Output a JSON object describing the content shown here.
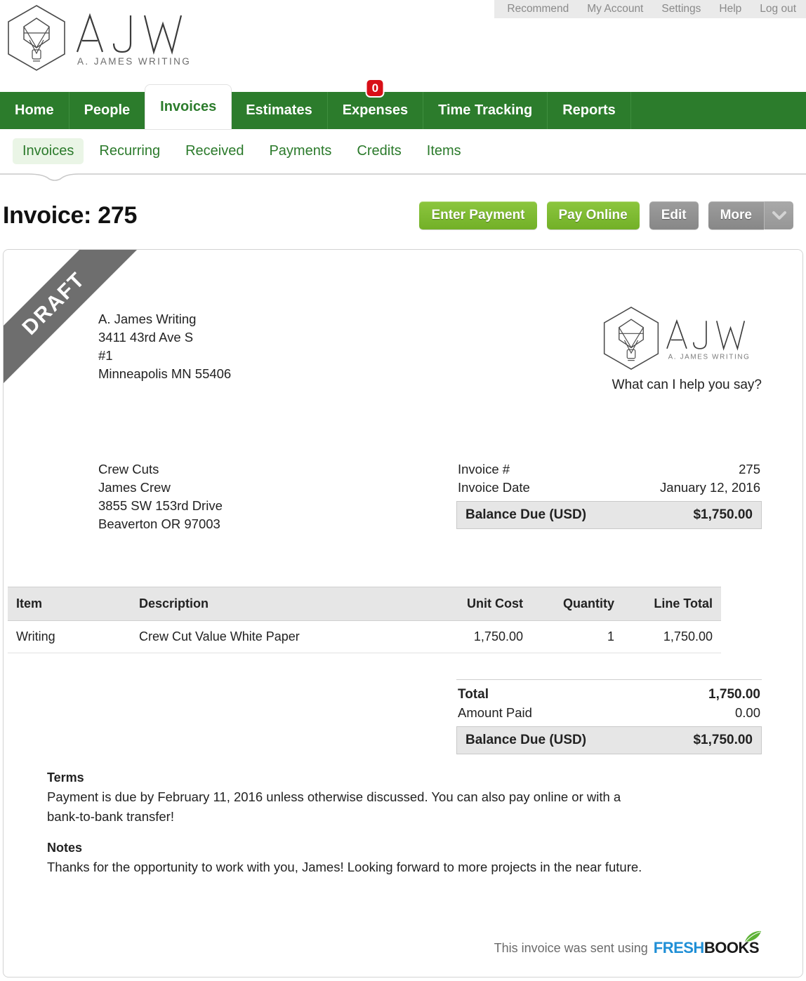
{
  "topbar": {
    "links": [
      {
        "label": "Recommend"
      },
      {
        "label": "My Account"
      },
      {
        "label": "Settings"
      },
      {
        "label": "Help"
      },
      {
        "label": "Log out"
      }
    ]
  },
  "brand": {
    "wordmark": "AJW",
    "subtitle": "A. JAMES WRITING"
  },
  "mainnav": {
    "tabs": [
      {
        "label": "Home",
        "active": false
      },
      {
        "label": "People",
        "active": false
      },
      {
        "label": "Invoices",
        "active": true
      },
      {
        "label": "Estimates",
        "active": false
      },
      {
        "label": "Expenses",
        "active": false,
        "badge": "0"
      },
      {
        "label": "Time Tracking",
        "active": false
      },
      {
        "label": "Reports",
        "active": false
      }
    ]
  },
  "subnav": {
    "items": [
      {
        "label": "Invoices",
        "active": true
      },
      {
        "label": "Recurring",
        "active": false
      },
      {
        "label": "Received",
        "active": false
      },
      {
        "label": "Payments",
        "active": false
      },
      {
        "label": "Credits",
        "active": false
      },
      {
        "label": "Items",
        "active": false
      }
    ]
  },
  "page": {
    "title": "Invoice: 275",
    "actions": {
      "enter_payment": "Enter Payment",
      "pay_online": "Pay Online",
      "edit": "Edit",
      "more": "More"
    }
  },
  "invoice": {
    "status_ribbon": "DRAFT",
    "from": {
      "name": "A. James Writing",
      "line1": "3411 43rd Ave S",
      "line2": "#1",
      "line3": "Minneapolis MN  55406"
    },
    "logo": {
      "wordmark": "AJW",
      "subtitle": "A. JAMES WRITING",
      "tagline": "What can I help you say?"
    },
    "bill_to": {
      "company": "Crew Cuts",
      "contact": "James Crew",
      "street": "3855 SW 153rd Drive",
      "citystate": "Beaverton OR  97003"
    },
    "meta": {
      "number_label": "Invoice #",
      "number_value": "275",
      "date_label": "Invoice Date",
      "date_value": "January 12, 2016",
      "balance_label": "Balance Due (USD)",
      "balance_value": "$1,750.00"
    },
    "table": {
      "headers": {
        "item": "Item",
        "description": "Description",
        "unit_cost": "Unit Cost",
        "quantity": "Quantity",
        "line_total": "Line Total"
      },
      "rows": [
        {
          "item": "Writing",
          "description": "Crew Cut Value White Paper",
          "unit_cost": "1,750.00",
          "quantity": "1",
          "line_total": "1,750.00"
        }
      ]
    },
    "totals": {
      "total_label": "Total",
      "total_value": "1,750.00",
      "paid_label": "Amount Paid",
      "paid_value": "0.00",
      "balance_label": "Balance Due (USD)",
      "balance_value": "$1,750.00"
    },
    "terms": {
      "heading": "Terms",
      "body": "Payment is due by February 11, 2016 unless otherwise discussed. You can also pay online or with a bank-to-bank transfer!"
    },
    "notes": {
      "heading": "Notes",
      "body": "Thanks for the opportunity to work with you, James! Looking forward to more projects in the near future."
    },
    "footer": {
      "text": "This invoice was sent using",
      "brand_first": "Fresh",
      "brand_second": "Books"
    }
  },
  "colors": {
    "nav_green": "#2c7c2c",
    "link_green": "#2b7a2b",
    "button_green": "#7fb92e",
    "button_gray": "#949494",
    "badge_red": "#d80f17",
    "ribbon_gray": "#6e6e6e"
  }
}
